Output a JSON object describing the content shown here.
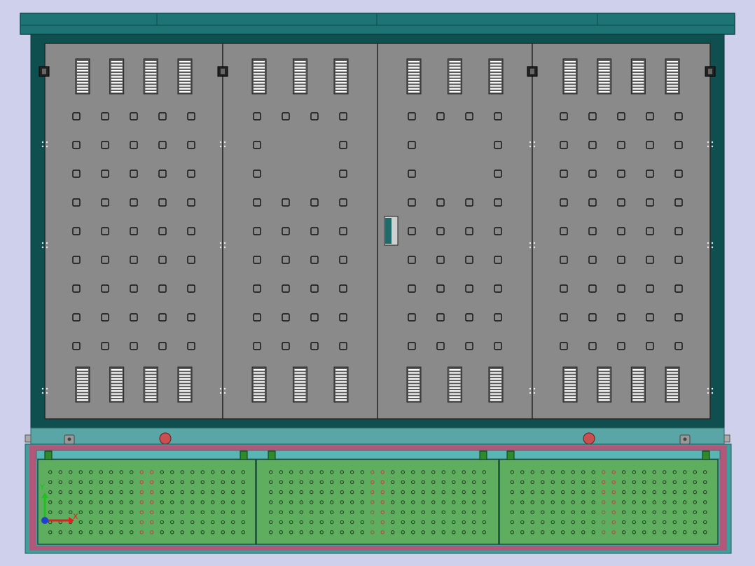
{
  "viewport": {
    "background": "#cfd0ec"
  },
  "model": {
    "colors": {
      "roof": "#1e7474",
      "roof_edge": "#0e4a4a",
      "frame": "#0f4f4f",
      "door_panel": "#8a8a8a",
      "door_outline": "#2a2a2a",
      "louver": "#ffffff",
      "base_beam": "#5aa6a6",
      "base_frame": "#b0577a",
      "base_frame_inner": "#3f9f9f",
      "mesh_panel": "#5fae5f",
      "mesh_hole": "#1f3a1f",
      "mesh_hole_red": "#c04040",
      "lifting_lug": "#c85050",
      "handle": "#1f6a6a",
      "hinge": "#222222"
    },
    "door_count": 4,
    "mesh_panel_count": 3,
    "hole_grid": {
      "rows": 9,
      "cols_outer": 5,
      "cols_inner": 4
    },
    "louvers_per_row": {
      "outer": 4,
      "inner": 3
    }
  },
  "triad": {
    "x_label": "X",
    "y_label": "Y",
    "x_color": "#e02020",
    "y_color": "#20c020",
    "z_color": "#2040d0"
  }
}
